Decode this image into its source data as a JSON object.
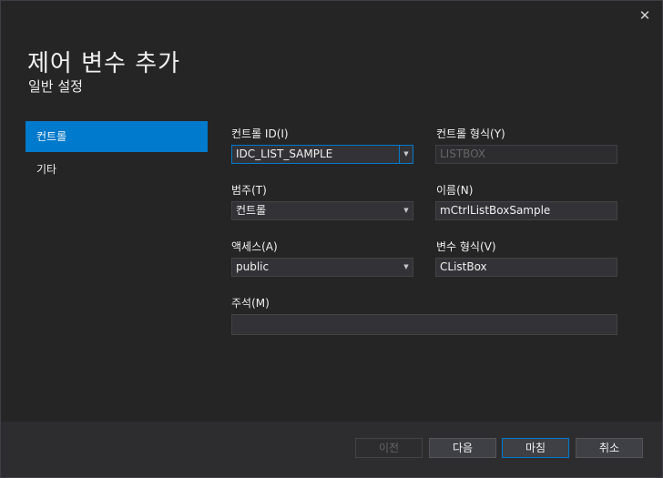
{
  "window": {
    "close_glyph": "✕",
    "title": "제어 변수 추가",
    "subtitle": "일반 설정"
  },
  "nav": {
    "items": [
      {
        "label": "컨트롤",
        "selected": true
      },
      {
        "label": "기타",
        "selected": false
      }
    ]
  },
  "form": {
    "control_id": {
      "label": "컨트롤 ID(I)",
      "value": "IDC_LIST_SAMPLE"
    },
    "control_type": {
      "label": "컨트롤 형식(Y)",
      "value": "LISTBOX"
    },
    "category": {
      "label": "범주(T)",
      "value": "컨트롤"
    },
    "name": {
      "label": "이름(N)",
      "value": "mCtrlListBoxSample"
    },
    "access": {
      "label": "액세스(A)",
      "value": "public"
    },
    "variable_type": {
      "label": "변수 형식(V)",
      "value": "CListBox"
    },
    "comment": {
      "label": "주석(M)",
      "value": ""
    }
  },
  "buttons": {
    "prev": "이전",
    "next": "다음",
    "finish": "마침",
    "cancel": "취소"
  },
  "icons": {
    "dropdown": "▼"
  },
  "colors": {
    "accent": "#007acc",
    "background": "#252526",
    "footer": "#2d2d30"
  }
}
